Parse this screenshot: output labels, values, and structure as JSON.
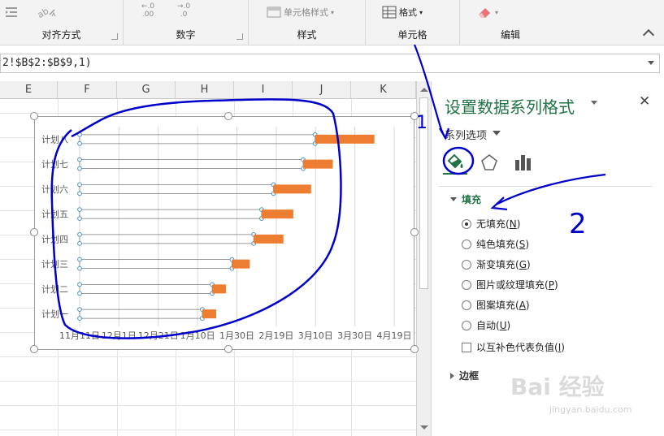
{
  "ribbon": {
    "groups": [
      {
        "label": "对齐方式"
      },
      {
        "label": "数字"
      },
      {
        "label": "样式",
        "button": "单元格样式"
      },
      {
        "label": "单元格",
        "button": "格式"
      },
      {
        "label": "编辑"
      }
    ],
    "number_inc": ".00",
    "number_dec": ".0",
    "number_small_a": "←.0",
    "number_small_b": "→.0"
  },
  "formula_bar": {
    "text": "2!$B$2:$B$9,1)"
  },
  "columns": [
    "E",
    "F",
    "G",
    "H",
    "I",
    "J",
    "K"
  ],
  "panel": {
    "title": "设置数据系列格式",
    "close": "✕",
    "series_options": "系列选项",
    "fill_section": "填充",
    "fill_options": [
      {
        "label": "无填充",
        "key": "N",
        "checked": true
      },
      {
        "label": "纯色填充",
        "key": "S",
        "checked": false
      },
      {
        "label": "渐变填充",
        "key": "G",
        "checked": false
      },
      {
        "label": "图片或纹理填充",
        "key": "P",
        "checked": false
      },
      {
        "label": "图案填充",
        "key": "A",
        "checked": false
      },
      {
        "label": "自动",
        "key": "U",
        "checked": false
      }
    ],
    "invert_label": "以互补色代表负值",
    "invert_key": "I",
    "border_section": "边框"
  },
  "annotations": {
    "one": "1",
    "two": "2"
  },
  "watermark": {
    "brand": "Bai 经验",
    "url": "jingyan.baidu.com"
  },
  "colors": {
    "accent": "#217346",
    "bar": "#ED7D31",
    "annotation": "#0000CC"
  },
  "chart_data": {
    "type": "bar",
    "orientation": "horizontal",
    "categories": [
      "计划八",
      "计划七",
      "计划六",
      "计划五",
      "计划四",
      "计划三",
      "计划二",
      "计划一"
    ],
    "x_tick_labels": [
      "11月11日",
      "12月1日",
      "12月21日",
      "1月10日",
      "1月30日",
      "2月19日",
      "3月10日",
      "3月30日",
      "4月19日"
    ],
    "xlim": [
      "2017-11-11",
      "2018-04-19"
    ],
    "series": [
      {
        "name": "",
        "fill": "none",
        "start": [
          "2017-11-11",
          "2017-11-11",
          "2017-11-11",
          "2017-11-11",
          "2017-11-11",
          "2017-11-11",
          "2017-11-11",
          "2017-11-11"
        ],
        "end": [
          "2018-03-10",
          "2018-03-04",
          "2018-02-17",
          "2018-02-11",
          "2018-02-07",
          "2018-01-27",
          "2018-01-17",
          "2018-01-12"
        ]
      },
      {
        "name": "",
        "fill": "#ED7D31",
        "start": [
          "2018-03-10",
          "2018-03-04",
          "2018-02-17",
          "2018-02-11",
          "2018-02-07",
          "2018-01-27",
          "2018-01-17",
          "2018-01-12"
        ],
        "end": [
          "2018-04-09",
          "2018-03-19",
          "2018-03-08",
          "2018-02-27",
          "2018-02-22",
          "2018-02-05",
          "2018-01-24",
          "2018-01-19"
        ]
      }
    ],
    "grid": true
  }
}
